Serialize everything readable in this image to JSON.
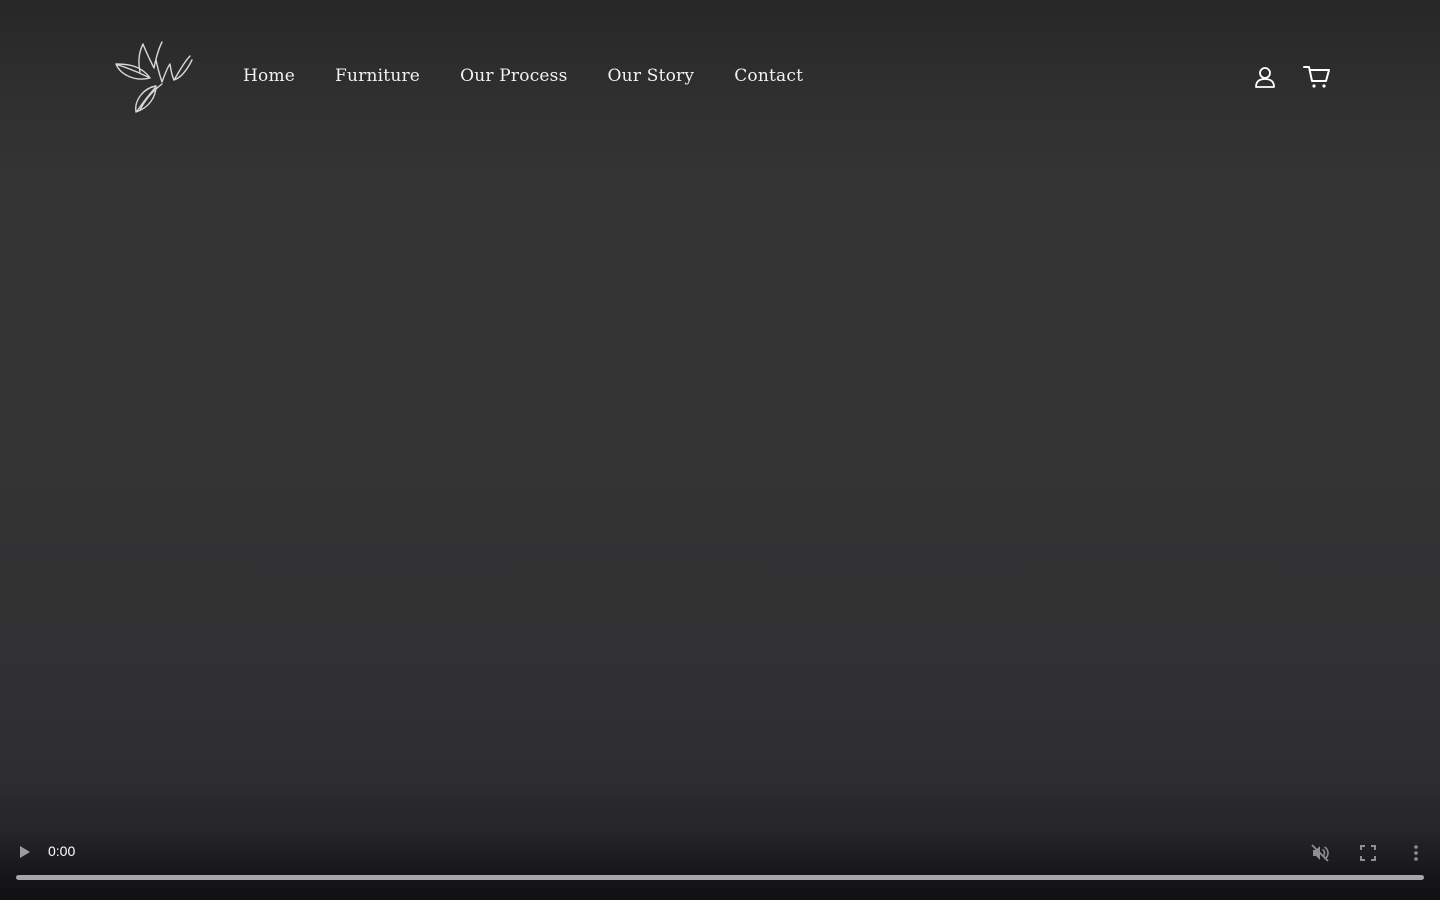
{
  "nav": {
    "items": [
      {
        "label": "Home"
      },
      {
        "label": "Furniture"
      },
      {
        "label": "Our Process"
      },
      {
        "label": "Our Story"
      },
      {
        "label": "Contact"
      }
    ]
  },
  "header": {
    "account_icon": "person-icon",
    "cart_icon": "cart-icon"
  },
  "video": {
    "time": "0:00",
    "progress": 0,
    "play_icon": "play-icon",
    "mute_icon": "muted-speaker-icon",
    "fullscreen_icon": "fullscreen-icon",
    "more_icon": "vertical-dots-icon"
  },
  "colors": {
    "background": "#333334",
    "text": "#ffffff",
    "progress_track": "#a7a7ab"
  }
}
